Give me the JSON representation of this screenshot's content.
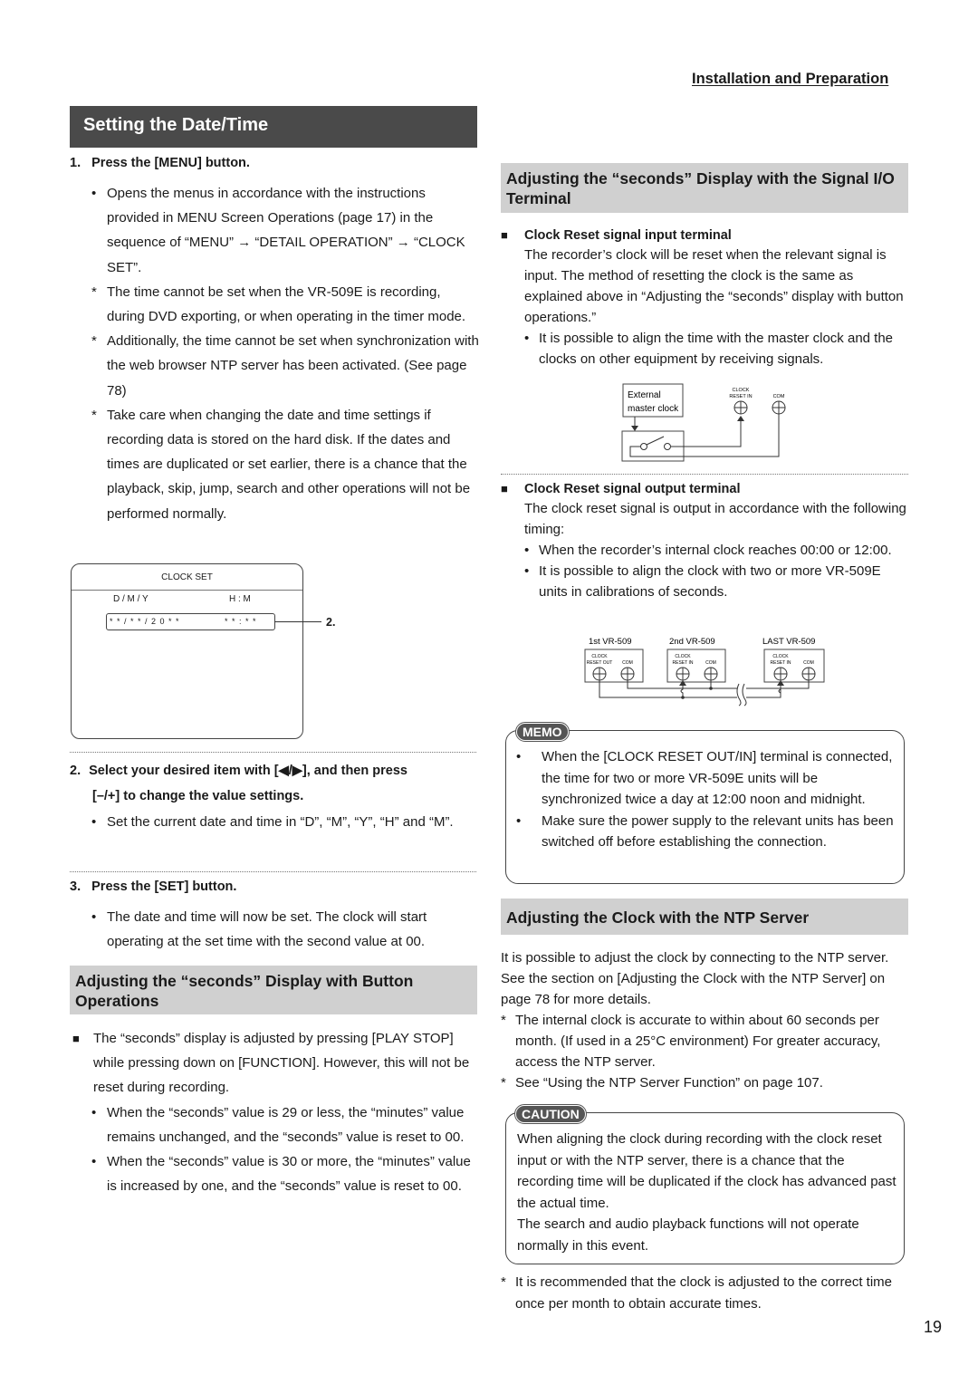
{
  "running_header": "Installation and Preparation",
  "page_number": "19",
  "left": {
    "title": "Setting the Date/Time",
    "step1": {
      "num": "1.",
      "label": "Press the [MENU] button.",
      "items": [
        {
          "marker": "•",
          "text": "Opens the menus in accordance with the instructions provided in MENU Screen Operations (page 17) in the sequence of “MENU” → “DETAIL OPERATION” → “CLOCK SET”."
        },
        {
          "marker": "*",
          "text": "The time cannot be set when the VR-509E is recording, during DVD exporting, or when operating in the timer mode."
        },
        {
          "marker": "*",
          "text": "Additionally, the time cannot be set when synchronization with the web browser NTP server has been activated. (See page 78)"
        },
        {
          "marker": "*",
          "text": "Take care when changing the date and time settings if recording data is stored on the hard disk. If the dates and times are duplicated or set earlier, there is a chance that the playback, skip, jump, search and other operations will not be performed normally."
        }
      ]
    },
    "clock_screen": {
      "title": "CLOCK SET",
      "date_label": "D / M  /   Y",
      "time_label": "H : M",
      "date_value": "* * / * * / 2 0 * *",
      "time_value": "* * : * *",
      "callout": "2."
    },
    "step2": {
      "num": "2.",
      "label_line1": "Select your desired item with [◀/▶], and then press",
      "label_line2": "[–/+] to change the value settings.",
      "items": [
        {
          "marker": "•",
          "text": "Set the current date and time in “D”, “M”, “Y”, “H” and “M”."
        }
      ]
    },
    "step3": {
      "num": "3.",
      "label": "Press the [SET] button.",
      "items": [
        {
          "marker": "•",
          "text": "The date and time will now be set. The clock will start operating at the set time with the second value at 00."
        }
      ]
    },
    "section2": {
      "title": "Adjusting the “seconds” Display with Button Operations",
      "lead_marker": "■",
      "lead": "The “seconds” display is adjusted by pressing [PLAY STOP] while pressing down on [FUNCTION]. However, this will not be reset during recording.",
      "items": [
        {
          "marker": "•",
          "text": "When the “seconds” value is 29 or less, the “minutes” value remains unchanged, and the “seconds” value is reset to 00."
        },
        {
          "marker": "•",
          "text": "When the “seconds” value is 30 or more, the “minutes” value is increased by one, and the “seconds” value is reset to 00."
        }
      ]
    }
  },
  "right": {
    "section1": {
      "title": "Adjusting the “seconds” Display with the Signal I/O Terminal",
      "input": {
        "marker": "■",
        "heading": "Clock Reset signal input terminal",
        "text": "The recorder’s clock will be reset when the relevant signal is input. The method of resetting the clock is the same as explained above in “Adjusting the “seconds” display with button operations.”",
        "items": [
          {
            "marker": "•",
            "text": "It is possible to align the time with the master clock and the clocks on other equipment by receiving signals."
          }
        ],
        "diagram": {
          "external_line1": "External",
          "external_line2": "master clock",
          "term1_line1": "CLOCK",
          "term1_line2": "RESET IN",
          "term2": "COM"
        }
      },
      "output": {
        "marker": "■",
        "heading": "Clock Reset signal output terminal",
        "text": "The clock reset signal is output in accordance with the following timing:",
        "items": [
          {
            "marker": "•",
            "text": "When the recorder’s internal clock reaches 00:00 or 12:00."
          },
          {
            "marker": "•",
            "text": "It is possible to align the clock with two or more VR-509E units in calibrations of seconds."
          }
        ],
        "diagram": {
          "unit1": "1st VR-509",
          "unit2": "2nd VR-509",
          "unit3": "LAST VR-509",
          "clock": "CLOCK",
          "reset_out": "RESET OUT",
          "reset_in": "RESET IN",
          "com": "COM"
        }
      }
    },
    "memo": {
      "badge": "MEMO",
      "items": [
        {
          "marker": "•",
          "text": "When the [CLOCK RESET OUT/IN] terminal is connected, the time for two or more VR-509E units will be synchronized twice a day at 12:00 noon and midnight."
        },
        {
          "marker": "•",
          "text": "Make sure the power supply to the relevant units has been switched off before establishing the connection."
        }
      ]
    },
    "section2": {
      "title": "Adjusting the Clock with the NTP Server",
      "text": "It is possible to adjust the clock by connecting to the NTP server. See the section on [Adjusting the Clock with the NTP Server] on page 78 for more details.",
      "items": [
        {
          "marker": "*",
          "text": "The internal clock is accurate to within about 60 seconds per month. (If used in a 25°C environment) For greater accuracy, access the NTP server."
        },
        {
          "marker": "*",
          "text": "See “Using the NTP Server Function” on page 107."
        }
      ]
    },
    "caution": {
      "badge": "CAUTION",
      "text1": "When aligning the clock during recording with the clock reset input or with the NTP server, there is a chance that the recording time will be duplicated if the clock has advanced past the actual time.",
      "text2": "The search and audio playback functions will not operate normally in this event."
    },
    "footnote": {
      "marker": "*",
      "text": "It is recommended that the clock is adjusted to the correct time once per month to obtain accurate times."
    }
  }
}
